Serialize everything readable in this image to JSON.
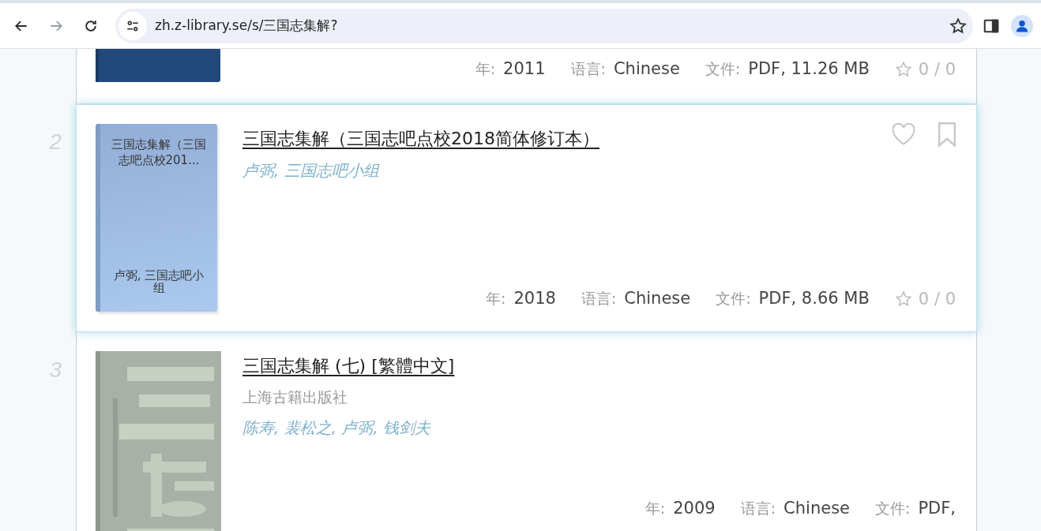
{
  "browser": {
    "url": "zh.z-library.se/s/三国志集解?",
    "forward_disabled": true
  },
  "results": [
    {
      "hovered": false,
      "cover": {
        "kind": "plain"
      },
      "meta": [
        {
          "label": "年:",
          "value": "2011"
        },
        {
          "label": "语言:",
          "value": "Chinese"
        },
        {
          "label": "文件:",
          "value": "PDF, 11.26 MB"
        }
      ],
      "rating": "0 / 0"
    },
    {
      "number": "2",
      "hovered": true,
      "cover": {
        "kind": "generated",
        "title": "三国志集解（三国志吧点校201...",
        "author": "卢弼, 三国志吧小组"
      },
      "title": "三国志集解（三国志吧点校2018简体修订本）",
      "authors": "卢弼, 三国志吧小组",
      "meta": [
        {
          "label": "年:",
          "value": "2018"
        },
        {
          "label": "语言:",
          "value": "Chinese"
        },
        {
          "label": "文件:",
          "value": "PDF, 8.66 MB"
        }
      ],
      "rating": "0 / 0"
    },
    {
      "number": "3",
      "hovered": false,
      "title": "三国志集解 (七) [繁體中文]",
      "publisher": "上海古籍出版社",
      "authors": "陈寿, 裴松之, 卢弼, 钱剑夫",
      "meta": [
        {
          "label": "年:",
          "value": "2009"
        },
        {
          "label": "语言:",
          "value": "Chinese"
        },
        {
          "label": "文件:",
          "value": "PDF,"
        }
      ]
    }
  ]
}
